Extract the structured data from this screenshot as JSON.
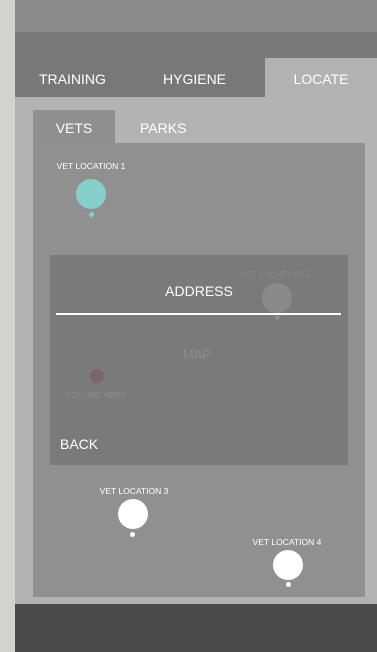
{
  "colors": {
    "accent_teal": "#86cfcb",
    "pin_white": "#ffffff",
    "user_marker": "#7b6565",
    "bottom_bar": "#4a4a4a"
  },
  "main_tabs": {
    "training": "TRAINING",
    "hygiene": "HYGIENE",
    "locate": "LOCATE",
    "active": "LOCATE"
  },
  "sub_tabs": {
    "vets": "VETS",
    "parks": "PARKS",
    "active": "VETS"
  },
  "locations": [
    {
      "label": "VET LOCATION 1",
      "icon": "map-pin-icon"
    },
    {
      "label": "VET LOCATION 2",
      "icon": "map-pin-icon"
    },
    {
      "label": "VET LOCATION 3",
      "icon": "map-pin-icon"
    },
    {
      "label": "VET LOCATION 4",
      "icon": "map-pin-icon"
    }
  ],
  "overlay": {
    "address_label": "ADDRESS",
    "map_label": "MAP",
    "user_marker_label": "YOU ARE HERE",
    "back_label": "BACK"
  }
}
